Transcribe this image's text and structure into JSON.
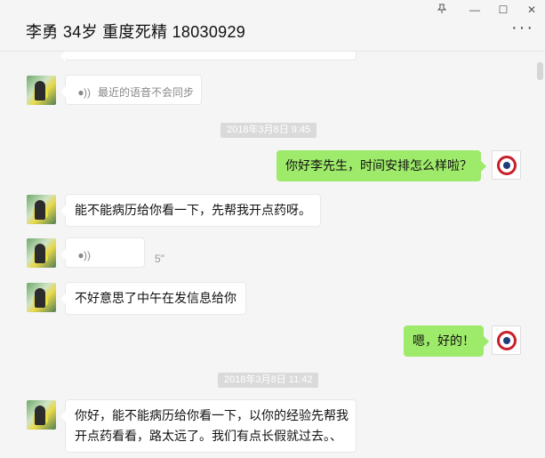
{
  "header": {
    "title": "李勇 34岁 重度死精 18030929",
    "pin_icon": "pin-icon",
    "minimize_label": "—",
    "maximize_label": "☐",
    "close_label": "✕",
    "more_label": "···"
  },
  "messages": {
    "voice_notice": "最近的语音不会同步",
    "time1": "2018年3月8日 9:45",
    "m1": "你好李先生，时间安排怎么样啦？",
    "m2": "能不能病历给你看一下，先帮我开点药呀。",
    "m3_duration": "5\"",
    "m4": "不好意思了中午在发信息给你",
    "m5": "嗯，好的！",
    "time2": "2018年3月8日 11:42",
    "m6_line1": "你好，能不能病历给你看一下，以你的经验先帮我",
    "m6_line2": "开点药看看，路太远了。我们有点长假就过去。、"
  },
  "icons": {
    "voice": "voice-icon"
  },
  "colors": {
    "sent_bubble": "#9eea6a",
    "received_bubble": "#ffffff",
    "background": "#f5f5f5"
  }
}
